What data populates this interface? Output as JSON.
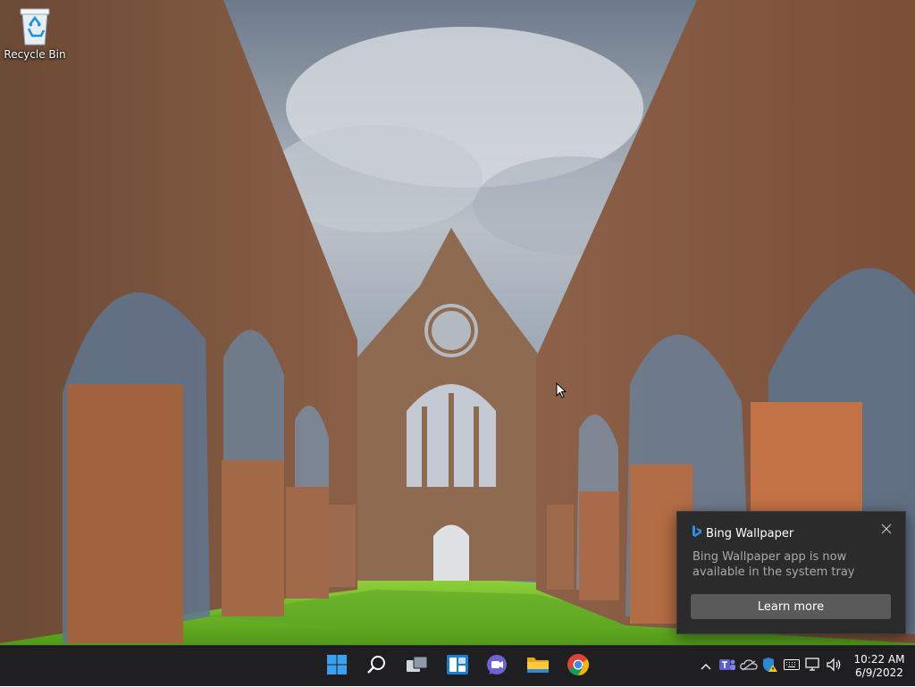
{
  "desktop": {
    "icons": [
      {
        "label": "Recycle Bin",
        "icon": "recycle-bin-icon"
      }
    ]
  },
  "notification": {
    "app_name": "Bing Wallpaper",
    "app_icon": "bing-icon",
    "message": "Bing Wallpaper app is now available in the system tray",
    "action_label": "Learn more",
    "close_icon": "close-icon"
  },
  "taskbar": {
    "pinned": [
      {
        "name": "Start",
        "icon": "windows-start-icon"
      },
      {
        "name": "Search",
        "icon": "search-icon"
      },
      {
        "name": "Task View",
        "icon": "task-view-icon"
      },
      {
        "name": "Widgets",
        "icon": "widgets-icon"
      },
      {
        "name": "Chat",
        "icon": "teams-chat-icon"
      },
      {
        "name": "File Explorer",
        "icon": "file-explorer-icon"
      },
      {
        "name": "Google Chrome",
        "icon": "chrome-icon"
      }
    ],
    "tray": [
      "chevron-up-icon",
      "teams-icon",
      "onedrive-icon",
      "security-warning-icon",
      "keyboard-icon",
      "network-icon",
      "volume-icon"
    ],
    "clock": {
      "time": "10:22 AM",
      "date": "6/9/2022"
    }
  },
  "colors": {
    "taskbar_bg": "#1f1f21",
    "toast_bg": "#2b2b2b",
    "toast_button": "#5a5a5a",
    "windows_blue": "#3aa0f2"
  }
}
